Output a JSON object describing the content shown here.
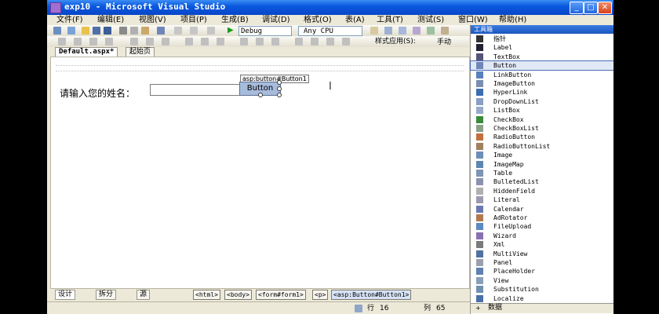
{
  "window": {
    "title": "exp10 - Microsoft Visual Studio"
  },
  "menu": [
    "文件(F)",
    "编辑(E)",
    "视图(V)",
    "项目(P)",
    "生成(B)",
    "调试(D)",
    "格式(O)",
    "表(A)",
    "工具(T)",
    "测试(S)",
    "窗口(W)",
    "帮助(H)"
  ],
  "toolbar": {
    "config": "Debug",
    "platform": "Any CPU",
    "style_apply_label": "样式应用(S):",
    "style_apply_value": "手动"
  },
  "tabs": [
    "Default.aspx*",
    "起始页"
  ],
  "designer": {
    "prompt": "请输入您的姓名：",
    "button_tag": "asp:button#Button1",
    "button_text": "Button"
  },
  "view_buttons": [
    "设计",
    "拆分",
    "源"
  ],
  "breadcrumb": [
    "<html>",
    "<body>",
    "<form#form1>",
    "<p>",
    "<asp:Button#Button1>"
  ],
  "statusbar": {
    "line_label": "行",
    "line": "16",
    "col_label": "列",
    "col": "65"
  },
  "toolbox": {
    "title": "工具箱",
    "items": [
      "指针",
      "Label",
      "TextBox",
      "Button",
      "LinkButton",
      "ImageButton",
      "HyperLink",
      "DropDownList",
      "ListBox",
      "CheckBox",
      "CheckBoxList",
      "RadioButton",
      "RadioButtonList",
      "Image",
      "ImageMap",
      "Table",
      "BulletedList",
      "HiddenField",
      "Literal",
      "Calendar",
      "AdRotator",
      "FileUpload",
      "Wizard",
      "Xml",
      "MultiView",
      "Panel",
      "PlaceHolder",
      "View",
      "Substitution",
      "Localize"
    ],
    "selected": "Button",
    "footer": "数据"
  },
  "colors": {
    "title_bar": "#0a5ae0",
    "chrome": "#ece9d8",
    "aspbutton": "#a7bbdb"
  }
}
